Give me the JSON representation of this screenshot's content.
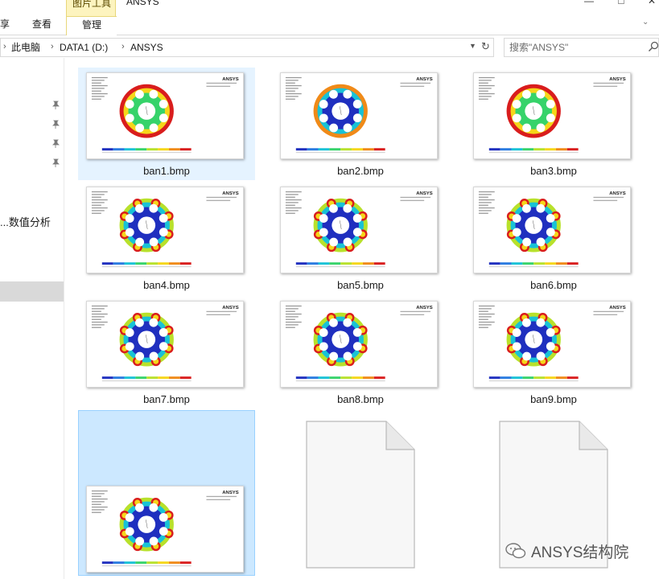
{
  "ribbon": {
    "tabs": [
      "享",
      "查看"
    ],
    "context_group": "图片工具",
    "context_tab": "管理",
    "window_title": "ANSYS"
  },
  "address": {
    "crumbs": [
      "此电脑",
      "DATA1 (D:)",
      "ANSYS"
    ]
  },
  "search": {
    "placeholder": "搜索\"ANSYS\""
  },
  "nav": {
    "label": "...数值分析"
  },
  "files": [
    {
      "name": "ban1.bmp",
      "pattern": "rim-red"
    },
    {
      "name": "ban2.bmp",
      "pattern": "blue-core"
    },
    {
      "name": "ban3.bmp",
      "pattern": "rim-red"
    },
    {
      "name": "ban4.bmp",
      "pattern": "hole-hot"
    },
    {
      "name": "ban5.bmp",
      "pattern": "hole-hot"
    },
    {
      "name": "ban6.bmp",
      "pattern": "hole-hot"
    },
    {
      "name": "ban7.bmp",
      "pattern": "hole-hot"
    },
    {
      "name": "ban8.bmp",
      "pattern": "hole-hot"
    },
    {
      "name": "ban9.bmp",
      "pattern": "hole-hot"
    }
  ],
  "thumb_text": {
    "logo": "ANSYS"
  },
  "watermark": {
    "text": "ANSYS结构院"
  },
  "icons": [
    "pin-icon",
    "search-icon",
    "refresh-icon",
    "chevron-down-icon",
    "wechat-icon"
  ],
  "colors": {
    "selection": "#cce8ff",
    "hover": "#e5f3ff",
    "context_tab": "#fdf4bf"
  }
}
